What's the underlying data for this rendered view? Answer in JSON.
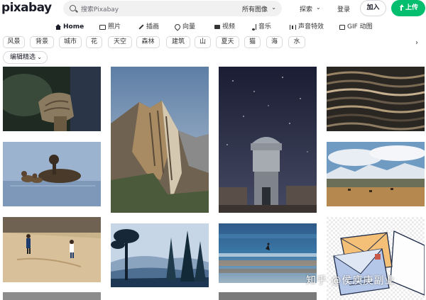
{
  "header": {
    "logo": "pixabay",
    "search_placeholder": "搜索Pixabay",
    "search_filter": "所有图像",
    "explore": "探索",
    "login": "登录",
    "join": "加入",
    "upload": "上传"
  },
  "nav": {
    "items": [
      {
        "label": "Home",
        "icon": "home-icon",
        "active": true
      },
      {
        "label": "照片",
        "icon": "camera-icon"
      },
      {
        "label": "插画",
        "icon": "brush-icon"
      },
      {
        "label": "向量",
        "icon": "pen-icon"
      },
      {
        "label": "视频",
        "icon": "video-icon"
      },
      {
        "label": "音乐",
        "icon": "music-icon"
      },
      {
        "label": "声音特效",
        "icon": "waveform-icon"
      },
      {
        "label": "GIF 动图",
        "icon": "gif-icon"
      }
    ]
  },
  "tags": [
    "风景",
    "背景",
    "城市",
    "花",
    "天空",
    "森林",
    "建筑",
    "山",
    "夏天",
    "猫",
    "海",
    "水"
  ],
  "editor_choice": "编辑精选",
  "watermark": "知乎 @侯庾庚副业"
}
